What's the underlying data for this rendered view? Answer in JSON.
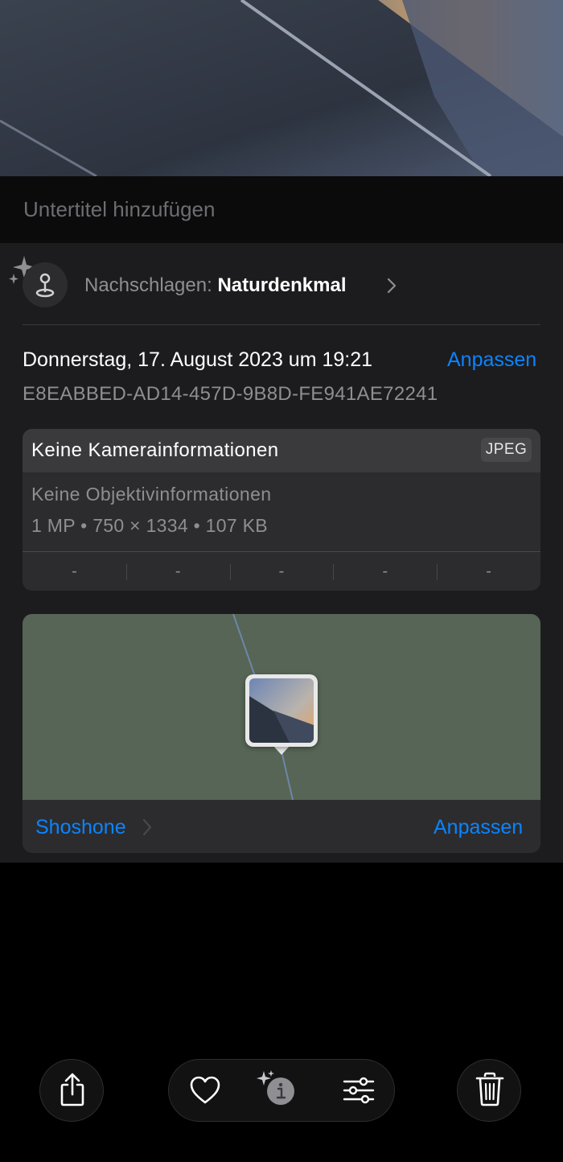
{
  "caption": {
    "placeholder": "Untertitel hinzufügen"
  },
  "lookup": {
    "prefix": "Nachschlagen:",
    "subject": "Naturdenkmal"
  },
  "details": {
    "date": "Donnerstag, 17. August 2023 um 19:21",
    "adjust_label": "Anpassen",
    "identifier": "E8EABBED-AD14-457D-9B8D-FE941AE72241"
  },
  "camera": {
    "title": "Keine Kamerainformationen",
    "format": "JPEG",
    "lens": "Keine Objektivinformationen",
    "specs": "1 MP • 750 × 1334 • 107 KB",
    "exif": [
      "-",
      "-",
      "-",
      "-",
      "-"
    ]
  },
  "location": {
    "place": "Shoshone",
    "adjust_label": "Anpassen"
  },
  "toolbar": {
    "icons": [
      "share-icon",
      "heart-icon",
      "info-icon",
      "adjust-sliders-icon",
      "trash-icon"
    ]
  },
  "colors": {
    "accent": "#0a84ff",
    "sheet": "#1c1c1e",
    "card": "#2c2c2e",
    "map": "#566555"
  }
}
